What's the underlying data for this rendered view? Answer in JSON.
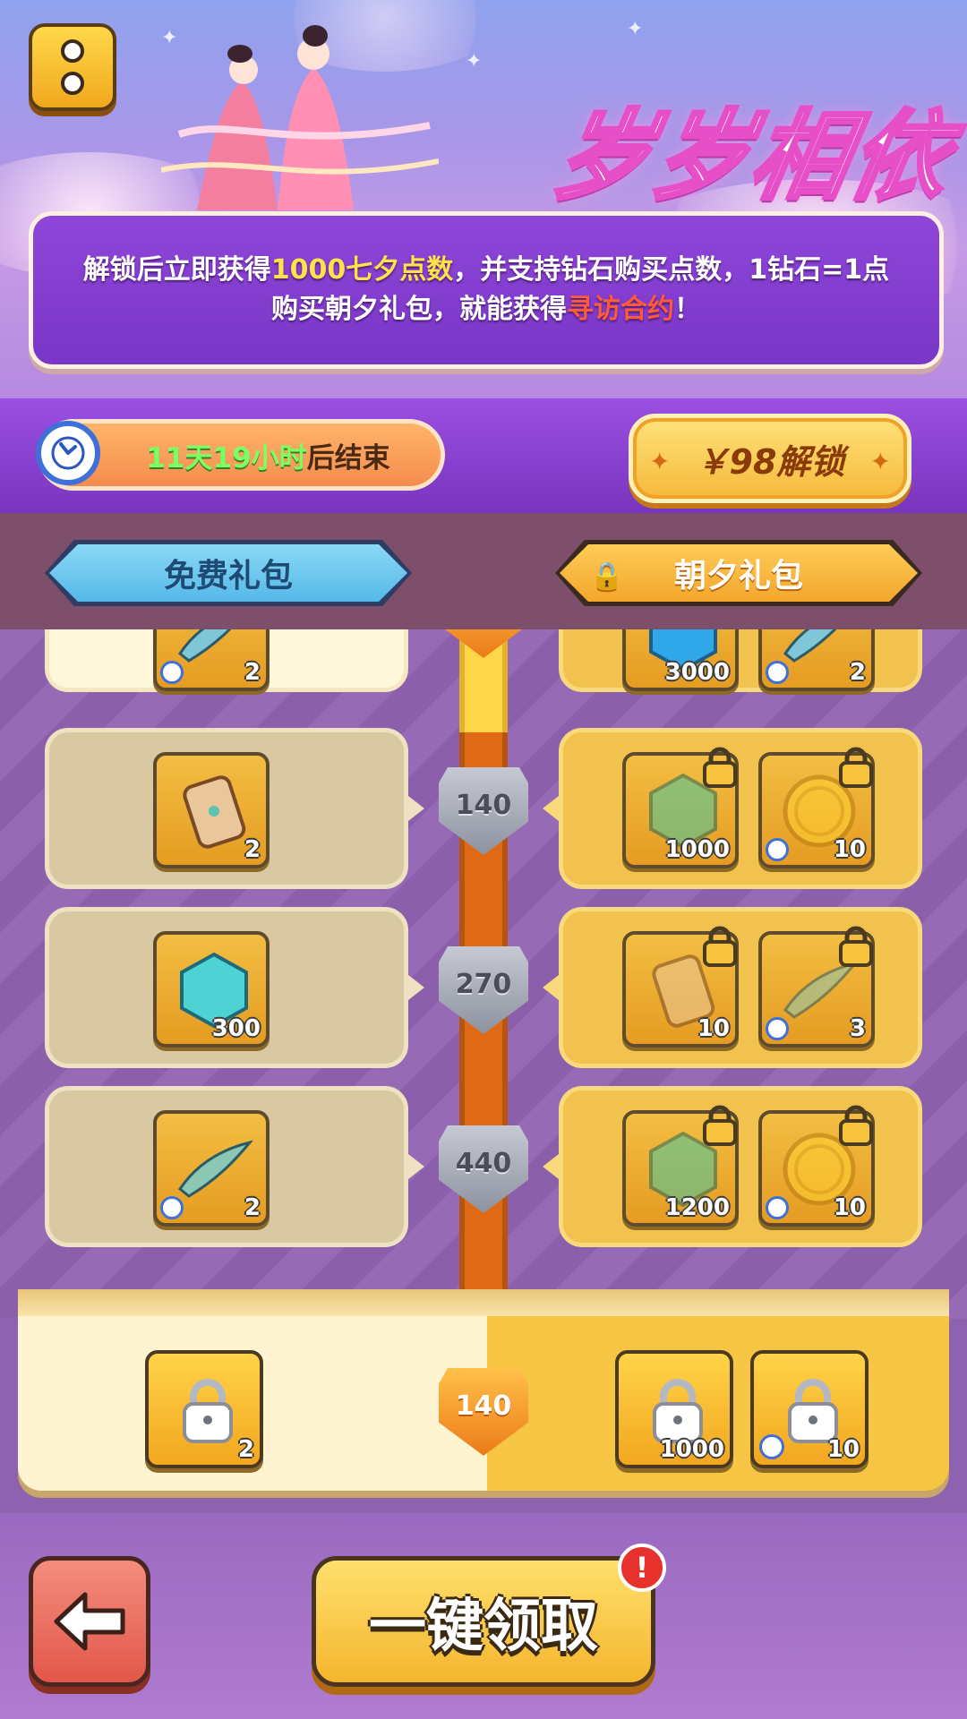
{
  "header": {
    "event_title": "岁岁相依",
    "description": {
      "line1_a": "解锁后立即获得",
      "line1_highlight": "1000七夕点数",
      "line1_b": "，并支持钻石购买点数，1钻石=1点",
      "line2_a": "购买朝夕礼包，就能获得",
      "line2_highlight": "寻访合约",
      "line2_b": "！"
    }
  },
  "timer": {
    "remaining": "11天19小时",
    "suffix": "后结束"
  },
  "unlock": {
    "label": "￥98解锁"
  },
  "tabs": {
    "free": "免费礼包",
    "paid": "朝夕礼包"
  },
  "rows": [
    {
      "level": "",
      "free": [
        {
          "icon": "fishing-lure-icon",
          "qty": "2",
          "timed": true
        }
      ],
      "paid": [
        {
          "icon": "gem-icon",
          "qty": "3000"
        },
        {
          "icon": "fishing-lure-icon",
          "qty": "2",
          "timed": true
        }
      ]
    },
    {
      "level": "140",
      "free": [
        {
          "icon": "scroll-icon",
          "qty": "2"
        }
      ],
      "paid": [
        {
          "icon": "gem-icon",
          "qty": "1000",
          "locked": true
        },
        {
          "icon": "gold-coin-icon",
          "qty": "10",
          "timed": true,
          "locked": true
        }
      ]
    },
    {
      "level": "270",
      "free": [
        {
          "icon": "gem-icon",
          "qty": "300"
        }
      ],
      "paid": [
        {
          "icon": "scroll-icon",
          "qty": "10",
          "locked": true
        },
        {
          "icon": "fishing-lure-icon",
          "qty": "3",
          "timed": true,
          "locked": true
        }
      ]
    },
    {
      "level": "440",
      "free": [
        {
          "icon": "fishing-lure-icon",
          "qty": "2",
          "timed": true
        }
      ],
      "paid": [
        {
          "icon": "gem-icon",
          "qty": "1200",
          "locked": true
        },
        {
          "icon": "gold-coin-icon",
          "qty": "10",
          "timed": true,
          "locked": true
        }
      ]
    }
  ],
  "milestone": {
    "level": "140",
    "free": [
      {
        "icon": "scroll-icon",
        "qty": "2"
      }
    ],
    "paid": [
      {
        "icon": "gem-icon",
        "qty": "1000"
      },
      {
        "icon": "gold-coin-icon",
        "qty": "10",
        "timed": true
      }
    ]
  },
  "footer": {
    "claim_label": "一键领取",
    "alert": "!"
  },
  "colors": {
    "accent_purple": "#8d46d8",
    "gold": "#f4b52e",
    "highlight_yellow": "#ffe14a",
    "highlight_red": "#ff5a3c",
    "timer_green": "#7cff63"
  }
}
